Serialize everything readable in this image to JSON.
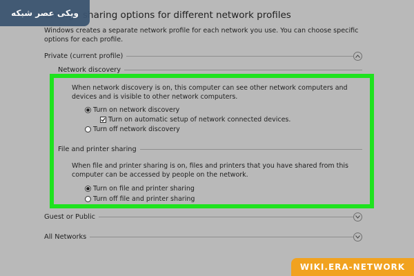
{
  "page": {
    "title": "Change sharing options for different network profiles",
    "subtitle": "Windows creates a separate network profile for each network you use. You can choose specific options for each profile."
  },
  "profiles": {
    "private": {
      "label": "Private (current profile)",
      "expanded": true,
      "icon": "chevron-up-icon"
    },
    "guest": {
      "label": "Guest or Public",
      "expanded": false,
      "icon": "chevron-down-icon"
    },
    "all": {
      "label": "All Networks",
      "expanded": false,
      "icon": "chevron-down-icon"
    }
  },
  "network_discovery": {
    "heading": "Network discovery",
    "description": "When network discovery is on, this computer can see other network computers and devices and is visible to other network computers.",
    "options": {
      "turn_on": "Turn on network discovery",
      "auto_setup": "Turn on automatic setup of network connected devices.",
      "turn_off": "Turn off network discovery"
    },
    "selected": "turn_on",
    "auto_setup_checked": true
  },
  "file_sharing": {
    "heading": "File and printer sharing",
    "description": "When file and printer sharing is on, files and printers that you have shared from this computer can be accessed by people on the network.",
    "options": {
      "turn_on": "Turn on file and printer sharing",
      "turn_off": "Turn off file and printer sharing"
    },
    "selected": "turn_on"
  },
  "watermarks": {
    "top_left": "ویکی عصر شبکه",
    "bottom_right": "WIKI.ERA-NETWORK"
  },
  "colors": {
    "background": "#b9b9b9",
    "highlight": "#1ee31e",
    "watermark_left_bg": "#3c5571",
    "watermark_right_bg": "#f1a21f"
  }
}
